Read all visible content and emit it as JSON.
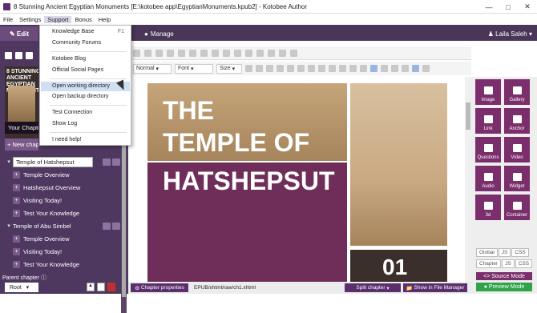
{
  "window": {
    "title": "8 Stunning Ancient Egyptian Monuments [E:\\kotobee app\\EgyptianMonuments.kpub2] - Kotobee Author"
  },
  "menu": {
    "items": [
      "File",
      "Settings",
      "Support",
      "Bonus",
      "Help"
    ]
  },
  "tabs": {
    "edit": "Edit",
    "manage": "Manage"
  },
  "user": {
    "name": "Laila Saleh"
  },
  "cover": {
    "title": "8 STUNNING ANCIENT EGYPTIAN MONUMENTS"
  },
  "sidebar": {
    "your_chapters": "Your Chapters",
    "new_chapter": "New chapter",
    "chapters": [
      {
        "label": "Temple of Hatshepsut",
        "level": 0,
        "selected": true
      },
      {
        "label": "Temple Overview",
        "level": 1
      },
      {
        "label": "Hatshepsut Overview",
        "level": 1
      },
      {
        "label": "Visiting Today!",
        "level": 1
      },
      {
        "label": "Test Your Knowledge",
        "level": 1
      },
      {
        "label": "Temple of Abu Simbel",
        "level": 0
      },
      {
        "label": "Temple Overview",
        "level": 1
      },
      {
        "label": "Visiting Today!",
        "level": 1
      },
      {
        "label": "Test Your Knowledge",
        "level": 1
      }
    ],
    "parent_chapter_label": "Parent chapter",
    "parent_chapter_value": "Root"
  },
  "support_menu": {
    "items": [
      {
        "label": "Knowledge Base",
        "shortcut": "F1"
      },
      {
        "label": "Community Forums"
      },
      {
        "label": "Kotobee Blog"
      },
      {
        "label": "Official Social Pages"
      },
      {
        "label": "Open working directory",
        "highlighted": true
      },
      {
        "label": "Open backup directory"
      },
      {
        "label": "Test Connection"
      },
      {
        "label": "Show Log"
      },
      {
        "label": "I need help!"
      }
    ]
  },
  "format": {
    "style": "Normal",
    "font": "Font",
    "size": "Size"
  },
  "editor": {
    "heading_line1": "THE",
    "heading_line2": "TEMPLE OF",
    "heading_line3": "HATSHEPSUT",
    "overlay_number": "01"
  },
  "tools": [
    "Image",
    "Gallery",
    "Link",
    "Anchor",
    "Questions",
    "Video",
    "Audio",
    "Widget",
    "3d",
    "Container"
  ],
  "code_modes": {
    "global": "Global",
    "chapter": "Chapter",
    "js": "JS",
    "css": "CSS",
    "source": "Source Mode",
    "preview": "Preview Mode"
  },
  "status": {
    "chapter_properties": "Chapter properties",
    "path": "EPUB/xhtml/raw/ch1.xhtml",
    "split_chapter": "Split chapter",
    "show_in_file_manager": "Show in File Manager"
  },
  "colors": {
    "brand_purple": "#5b2e6e",
    "sidebar": "#4f3860",
    "accent_green": "#2fa34a",
    "tile": "#7a2e6b"
  }
}
